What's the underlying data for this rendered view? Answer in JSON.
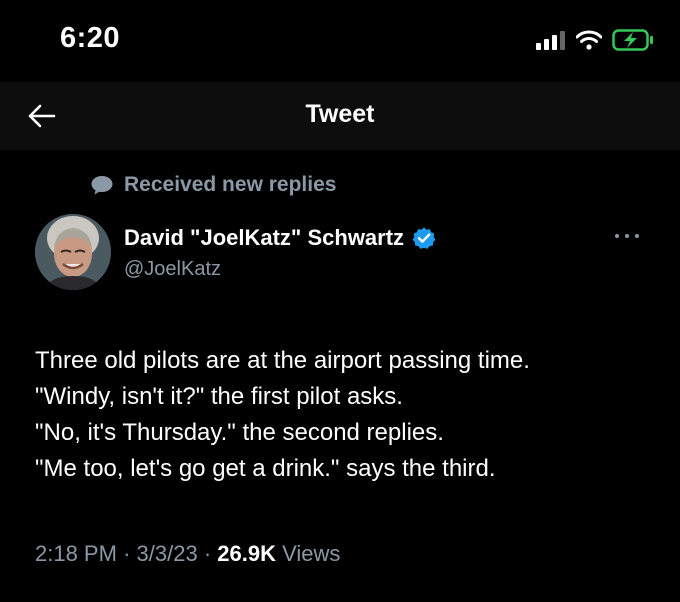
{
  "status_bar": {
    "time": "6:20",
    "icons": [
      "cellular-signal-icon",
      "wifi-icon",
      "battery-charging-icon"
    ],
    "battery_color": "#34c759"
  },
  "nav": {
    "title": "Tweet",
    "back_icon": "back-arrow-icon"
  },
  "notice": {
    "icon": "speech-bubble-icon",
    "label": "Received new replies"
  },
  "tweet": {
    "author_name": "David \"JoelKatz\" Schwartz",
    "verified_icon": "verified-badge-icon",
    "verified_color": "#1d9bf0",
    "handle": "@JoelKatz",
    "more_icon": "more-options-icon",
    "lines": [
      "Three old pilots are at the airport passing time.",
      "\"Windy, isn't it?\" the first pilot asks.",
      "\"No, it's Thursday.\" the second replies.",
      "\"Me too, let's go get a drink.\" says the third."
    ],
    "time": "2:18 PM",
    "date": "3/3/23",
    "separator": "·",
    "views_count": "26.9K",
    "views_label": "Views"
  }
}
